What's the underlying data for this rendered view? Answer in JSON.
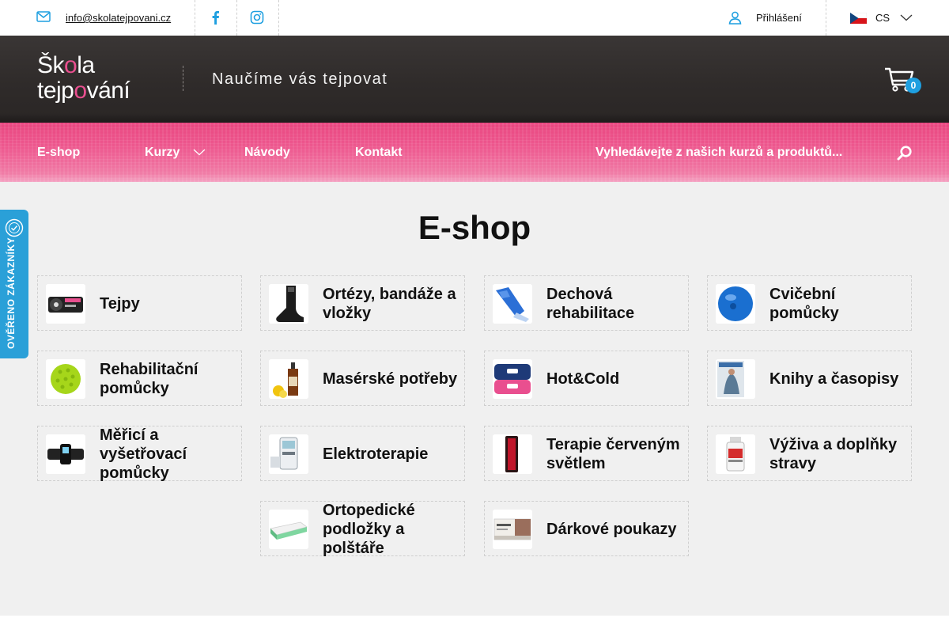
{
  "topbar": {
    "email": "info@skolatejpovani.cz",
    "login_label": "Přihlášení",
    "language": "CS"
  },
  "header": {
    "logo_line1_pre": "Šk",
    "logo_line1_o": "o",
    "logo_line1_post": "la",
    "logo_line2_pre": "tejp",
    "logo_line2_o": "o",
    "logo_line2_post": "vání",
    "tagline": "Naučíme vás tejpovat",
    "cart_count": "0"
  },
  "nav": {
    "items": [
      {
        "label": "E-shop"
      },
      {
        "label": "Kurzy"
      },
      {
        "label": "Návody"
      },
      {
        "label": "Kontakt"
      }
    ],
    "search_placeholder": "Vyhledávejte z našich kurzů a produktů..."
  },
  "main": {
    "title": "E-shop",
    "categories": [
      {
        "label": "Tejpy",
        "icon": "tape-rolls-thumb"
      },
      {
        "label": "Ortézy, bandáže a vložky",
        "icon": "ankle-brace-thumb"
      },
      {
        "label": "Dechová rehabilitace",
        "icon": "breathing-trainer-thumb"
      },
      {
        "label": "Cvičební pomůcky",
        "icon": "exercise-ball-thumb"
      },
      {
        "label": "Rehabilitační pomůcky",
        "icon": "massage-ball-thumb"
      },
      {
        "label": "Masérské potřeby",
        "icon": "massage-oil-thumb"
      },
      {
        "label": "Hot&Cold",
        "icon": "hot-cold-pack-thumb"
      },
      {
        "label": "Knihy a časopisy",
        "icon": "magazine-thumb"
      },
      {
        "label": "Měřicí a vyšetřovací pomůcky",
        "icon": "measuring-device-thumb"
      },
      {
        "label": "Elektroterapie",
        "icon": "tens-device-thumb"
      },
      {
        "label": "Terapie červeným světlem",
        "icon": "red-light-panel-thumb"
      },
      {
        "label": "Výživa a doplňky stravy",
        "icon": "supplement-bottle-thumb"
      },
      {
        "label": "Ortopedické podložky a polštáře",
        "icon": "orthopedic-pad-thumb"
      },
      {
        "label": "Dárkové poukazy",
        "icon": "gift-voucher-thumb"
      }
    ]
  },
  "badge": {
    "text": "OVĚŘENO ZÁKAZNÍKY"
  },
  "colors": {
    "brand_pink": "#e94f8f",
    "header_dark": "#2f2b2a",
    "accent_blue": "#1e9fe0",
    "badge_blue": "#2aa0d8",
    "page_bg": "#f0f0f0"
  }
}
